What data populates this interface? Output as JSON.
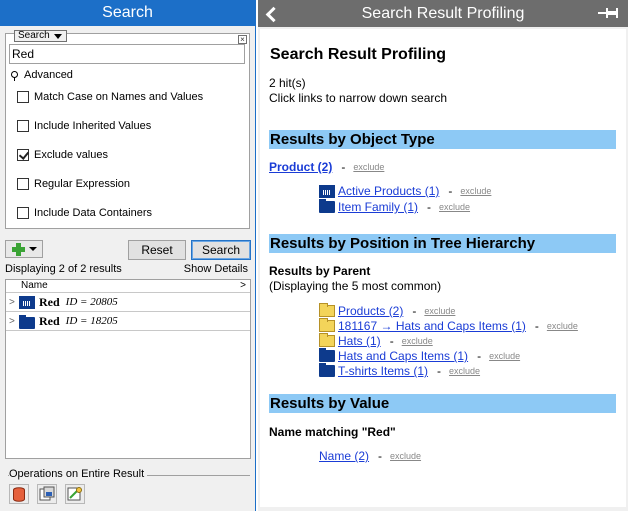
{
  "left": {
    "title": "Search",
    "search_tab_label": "Search",
    "search_value": "Red",
    "advanced_label": "Advanced",
    "options": [
      {
        "label": "Match Case on Names and Values",
        "checked": false
      },
      {
        "label": "Include Inherited Values",
        "checked": false
      },
      {
        "label": "Exclude values",
        "checked": true
      },
      {
        "label": "Regular Expression",
        "checked": false
      },
      {
        "label": "Include Data Containers",
        "checked": false
      }
    ],
    "reset_label": "Reset",
    "search_label": "Search",
    "displaying": "Displaying 2 of 2 results",
    "show_details": "Show Details",
    "table_header": "Name",
    "results": [
      {
        "name": "Red",
        "id": "ID = 20805",
        "icon": "product-icon"
      },
      {
        "name": "Red",
        "id": "ID = 18205",
        "icon": "folder-blue-icon"
      }
    ],
    "operations_label": "Operations on Entire Result"
  },
  "right": {
    "header_title": "Search Result Profiling",
    "title": "Search Result Profiling",
    "hits": "2 hit(s)",
    "hint": "Click links to narrow down search",
    "exclude": "exclude",
    "dash": "-",
    "sections": {
      "object_type": {
        "title": "Results by Object Type",
        "top": {
          "label": "Product (2)"
        },
        "items": [
          {
            "label": "Active Products (1)",
            "icon": "product-icon"
          },
          {
            "label": "Item Family (1)",
            "icon": "folder-blue-icon"
          }
        ]
      },
      "tree": {
        "title": "Results by Position in Tree Hierarchy",
        "sub": "Results by Parent",
        "note": "(Displaying the 5 most common)",
        "items": [
          {
            "label": "Products (2)",
            "icon": "folder-yellow-icon"
          },
          {
            "label": "181167 → Hats and Caps Items (1)",
            "icon": "folder-yellow-icon"
          },
          {
            "label": "Hats (1)",
            "icon": "folder-yellow-icon"
          },
          {
            "label": "Hats and Caps Items (1)",
            "icon": "folder-blue-icon"
          },
          {
            "label": "T-shirts Items (1)",
            "icon": "folder-blue-icon"
          }
        ]
      },
      "value": {
        "title": "Results by Value",
        "sub": "Name matching \"Red\"",
        "items": [
          {
            "label": "Name (2)"
          }
        ]
      }
    }
  },
  "colors": {
    "left_header": "#1c6fc8",
    "right_header": "#6d6d6d",
    "section_bar": "#8dc9f5",
    "link": "#1a3cd6"
  }
}
